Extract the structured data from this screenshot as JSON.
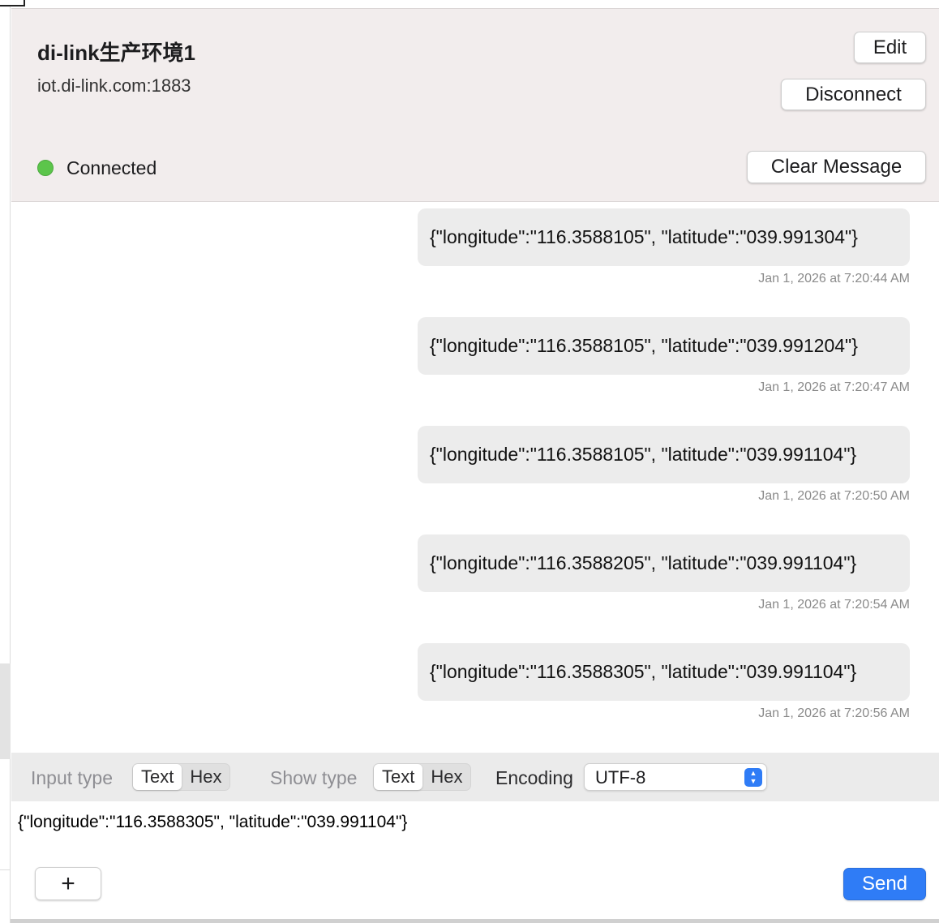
{
  "connection": {
    "name": "di-link生产环境1",
    "host": "iot.di-link.com:1883",
    "status": "Connected"
  },
  "header_buttons": {
    "edit": "Edit",
    "disconnect": "Disconnect",
    "clear": "Clear Message"
  },
  "messages": [
    {
      "text": "{\"longitude\":\"116.3588105\", \"latitude\":\"039.991304\"}",
      "time": "Jan 1, 2026 at 7:20:44 AM"
    },
    {
      "text": "{\"longitude\":\"116.3588105\", \"latitude\":\"039.991204\"}",
      "time": "Jan 1, 2026 at 7:20:47 AM"
    },
    {
      "text": "{\"longitude\":\"116.3588105\", \"latitude\":\"039.991104\"}",
      "time": "Jan 1, 2026 at 7:20:50 AM"
    },
    {
      "text": "{\"longitude\":\"116.3588205\", \"latitude\":\"039.991104\"}",
      "time": "Jan 1, 2026 at 7:20:54 AM"
    },
    {
      "text": "{\"longitude\":\"116.3588305\", \"latitude\":\"039.991104\"}",
      "time": "Jan 1, 2026 at 7:20:56 AM"
    }
  ],
  "toolbar": {
    "input_type_label": "Input type",
    "show_type_label": "Show type",
    "encoding_label": "Encoding",
    "text_option": "Text",
    "hex_option": "Hex",
    "input_type_selected": "Text",
    "show_type_selected": "Text",
    "encoding_value": "UTF-8"
  },
  "composer": {
    "value": "{\"longitude\":\"116.3588305\", \"latitude\":\"039.991104\"}",
    "add_label": "+",
    "send_label": "Send"
  },
  "colors": {
    "status_connected": "#5cc54b",
    "accent": "#2f7cf6",
    "header_bg": "#f2eded",
    "bubble_bg": "#ececec"
  },
  "icons": {
    "status": "status-dot-icon",
    "select_arrows": "chevron-up-down-icon",
    "add": "plus-icon"
  }
}
